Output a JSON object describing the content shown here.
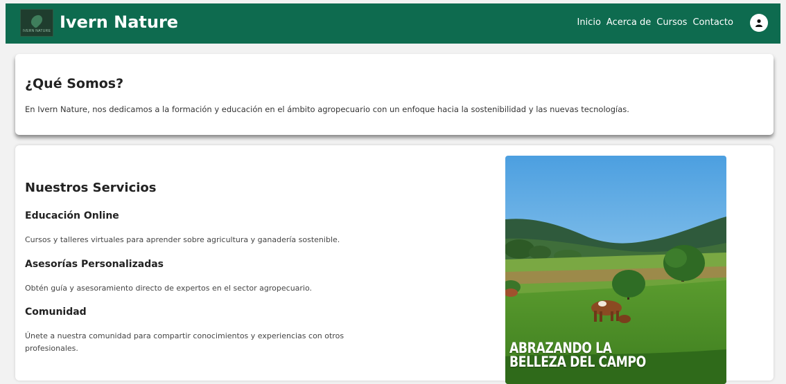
{
  "header": {
    "brand": "Ivern Nature",
    "logo_caption": "IVERN NATURE",
    "nav": [
      "Inicio",
      "Acerca de",
      "Cursos",
      "Contacto"
    ],
    "avatar_icon": "user-icon"
  },
  "about": {
    "title": "¿Qué Somos?",
    "text": "En Ivern Nature, nos dedicamos a la formación y educación en el ámbito agropecuario con un enfoque hacia la sostenibilidad y las nuevas tecnologías."
  },
  "services": {
    "title": "Nuestros Servicios",
    "items": [
      {
        "heading": "Educación Online",
        "description": "Cursos y talleres virtuales para aprender sobre agricultura y ganadería sostenible."
      },
      {
        "heading": "Asesorías Personalizadas",
        "description": "Obtén guía y asesoramiento directo de expertos en el sector agropecuario."
      },
      {
        "heading": "Comunidad",
        "description": "Únete a nuestra comunidad para compartir conocimientos y experiencias con otros profesionales."
      }
    ],
    "image": {
      "line1": "ABRAZANDO LA",
      "line2": "BELLEZA DEL CAMPO"
    }
  },
  "colors": {
    "header_bg": "#0e6b4f",
    "page_bg": "#f2f2f2",
    "card_bg": "#ffffff"
  }
}
